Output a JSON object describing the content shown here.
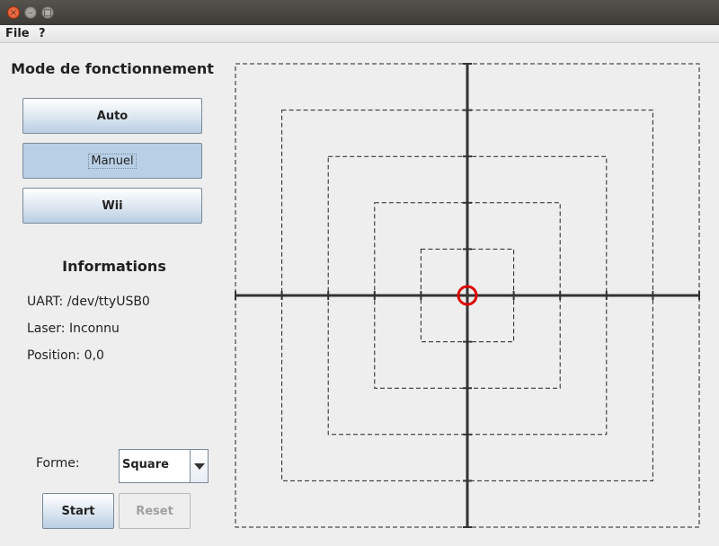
{
  "window": {
    "close_glyph": "×",
    "min_glyph": "–",
    "max_glyph": "□"
  },
  "menu": {
    "file": "File",
    "help": "?"
  },
  "mode": {
    "title": "Mode de fonctionnement",
    "buttons": [
      {
        "label": "Auto"
      },
      {
        "label": "Manuel",
        "selected": true
      },
      {
        "label": "Wii"
      }
    ]
  },
  "info": {
    "title": "Informations",
    "uart": "UART: /dev/ttyUSB0",
    "laser": "Laser: Inconnu",
    "position": "Position: 0,0"
  },
  "shape": {
    "label": "Forme:",
    "selected": "Square",
    "start_label": "Start",
    "reset_label": "Reset"
  },
  "colors": {
    "target": "#dd0000",
    "axis": "#333333",
    "dashes": "#222222"
  },
  "icons": {
    "dropdown": "chevron-down-icon"
  }
}
